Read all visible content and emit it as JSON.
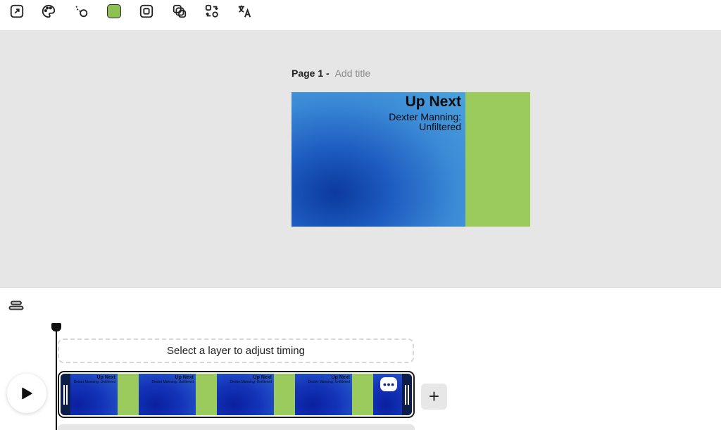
{
  "toolbar": {
    "tools": [
      {
        "icon": "resize-icon"
      },
      {
        "icon": "palette-icon"
      },
      {
        "icon": "animation-path-icon"
      },
      {
        "icon": "color-swatch-icon",
        "color": "#8dc152"
      },
      {
        "icon": "crop-frame-icon"
      },
      {
        "icon": "duplicate-layers-icon"
      },
      {
        "icon": "swap-icon"
      },
      {
        "icon": "translate-icon"
      }
    ]
  },
  "canvas": {
    "page_label": "Page 1 -",
    "title_placeholder": "Add title",
    "heading": "Up Next",
    "subheading": "Dexter Manning: Unfiltered",
    "colors": {
      "gradient_dark": "#0b3a9c",
      "gradient_light": "#4aa3de",
      "green_panel": "#9bca5d"
    }
  },
  "timeline": {
    "timing_hint": "Select a layer to adjust timing",
    "thumbnails": [
      {
        "heading": "Up Next",
        "subheading": "Dexter Manning: Unfiltered"
      },
      {
        "heading": "Up Next",
        "subheading": "Dexter Manning: Unfiltered"
      },
      {
        "heading": "Up Next",
        "subheading": "Dexter Manning: Unfiltered"
      },
      {
        "heading": "Up Next",
        "subheading": "Dexter Manning: Unfiltered"
      }
    ],
    "add_label": "+"
  }
}
